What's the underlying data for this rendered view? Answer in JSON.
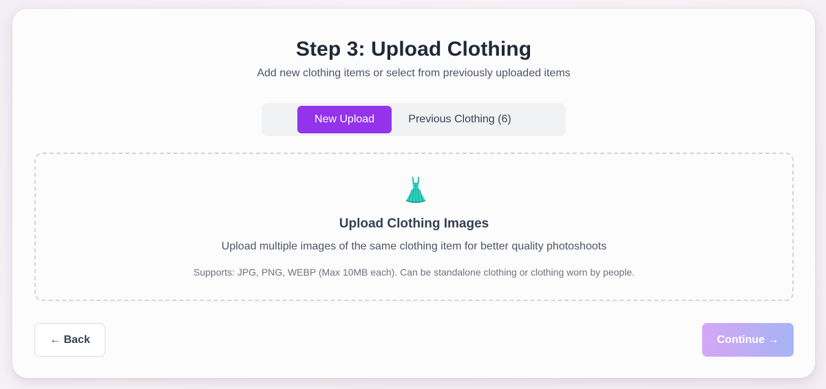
{
  "header": {
    "title": "Step 3: Upload Clothing",
    "subtitle": "Add new clothing items or select from previously uploaded items"
  },
  "tabs": [
    {
      "label": "New Upload",
      "active": true
    },
    {
      "label": "Previous Clothing (6)",
      "active": false
    }
  ],
  "dropzone": {
    "icon": "dress-icon",
    "title": "Upload Clothing Images",
    "description": "Upload multiple images of the same clothing item for better quality photoshoots",
    "note": "Supports: JPG, PNG, WEBP (Max 10MB each). Can be standalone clothing or clothing worn by people."
  },
  "footer": {
    "back_label": "← Back",
    "continue_label": "Continue →"
  },
  "colors": {
    "accent": "#9333ea",
    "continue_gradient_start": "#d5a6f4",
    "continue_gradient_end": "#a6b4f5"
  }
}
